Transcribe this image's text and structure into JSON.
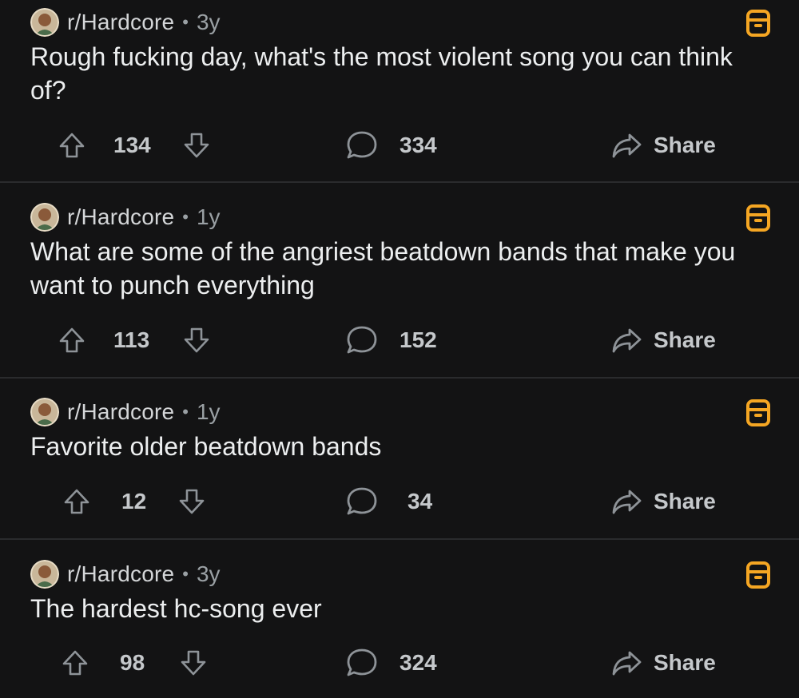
{
  "colors": {
    "background": "#131314",
    "divider": "#2a2b2d",
    "save_accent": "#f5a623",
    "text_primary": "#eceeef",
    "text_secondary": "#9aa0a4"
  },
  "icons": {
    "avatar": "subreddit-avatar-icon",
    "save": "saved-bookmark-icon",
    "upvote": "upvote-arrow-icon",
    "downvote": "downvote-arrow-icon",
    "comment": "comment-bubble-icon",
    "share": "share-arrow-icon"
  },
  "share_label": "Share",
  "posts": [
    {
      "subreddit": "r/Hardcore",
      "separator": "•",
      "age": "3y",
      "title": "Rough fucking day, what's the most violent song you can think of?",
      "votes": "134",
      "comments": "334"
    },
    {
      "subreddit": "r/Hardcore",
      "separator": "•",
      "age": "1y",
      "title": "What are some of the angriest beatdown bands that make you want to punch everything",
      "votes": "113",
      "comments": "152"
    },
    {
      "subreddit": "r/Hardcore",
      "separator": "•",
      "age": "1y",
      "title": "Favorite older beatdown bands",
      "votes": "12",
      "comments": "34"
    },
    {
      "subreddit": "r/Hardcore",
      "separator": "•",
      "age": "3y",
      "title": "The hardest hc-song ever",
      "votes": "98",
      "comments": "324"
    }
  ]
}
